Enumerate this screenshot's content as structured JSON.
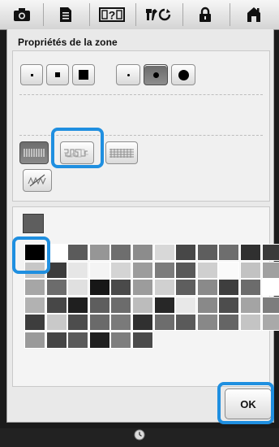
{
  "tabs": [
    {
      "icon": "camera-icon",
      "label": ""
    },
    {
      "icon": "document-icon",
      "label": ""
    },
    {
      "icon": "help-icon",
      "label": "?"
    },
    {
      "icon": "settings-icon",
      "label": ""
    },
    {
      "icon": "lock-icon",
      "label": ""
    },
    {
      "icon": "home-icon",
      "label": ""
    }
  ],
  "dialog": {
    "title": "Propriétés de la zone",
    "ok_label": "OK"
  },
  "size_options": {
    "selected_index": 4,
    "items": [
      "small-square",
      "medium-square",
      "large-square",
      "small-dot",
      "medium-dot",
      "large-dot"
    ]
  },
  "stitch_patterns": {
    "selected_index": 1,
    "highlighted_index": 1,
    "items": [
      "fill-stitch",
      "meander-stitch",
      "dense-stitch",
      "no-stitch"
    ]
  },
  "palette": {
    "current_color": "#5e5e5e",
    "selected_color": "#000000",
    "colors": [
      [
        "#000000",
        "#ffffff",
        "#5b5b5b",
        "#969696",
        "#6e6e6e",
        "#8c8c8c",
        "#d8d8d8",
        "#474747",
        "#5e5e5e",
        "#6e6e6e",
        "#303030",
        "#3a3a3a"
      ],
      [
        "#c7c7c7",
        "#3c3c3c",
        "#e6e6e6",
        "#f4f4f4",
        "#d4d4d4",
        "#9c9c9c",
        "#7c7c7c",
        "#595959",
        "#cfcfcf",
        "#fafafa",
        "#c2c2c2",
        "#a0a0a0"
      ],
      [
        "#a6a6a6",
        "#6c6c6c",
        "#e0e0e0",
        "#171717",
        "#4a4a4a",
        "#9c9c9c",
        "#d0d0d0",
        "#5e5e5e",
        "#8a8a8a",
        "#3e3e3e",
        "#6c6c6c",
        "#ffffff"
      ],
      [
        "#b2b2b2",
        "#474747",
        "#1f1f1f",
        "#5e5e5e",
        "#6c6c6c",
        "#bcbcbc",
        "#272727",
        "#e8e8e8",
        "#898989",
        "#4d4d4d",
        "#a4a4a4",
        "#7d7d7d"
      ],
      [
        "#3d3d3d",
        "#c9c9c9",
        "#4d4d4d",
        "#6a6a6a",
        "#7a7a7a",
        "#303030",
        "#6d6d6d",
        "#5a5a5a",
        "#888888",
        "#656565",
        "#c4c4c4",
        "#a9a9a9"
      ],
      [
        "#9a9a9a",
        "#454545",
        "#5a5a5a",
        "#202020",
        "#7e7e7e",
        "#4a4a4a"
      ]
    ]
  }
}
